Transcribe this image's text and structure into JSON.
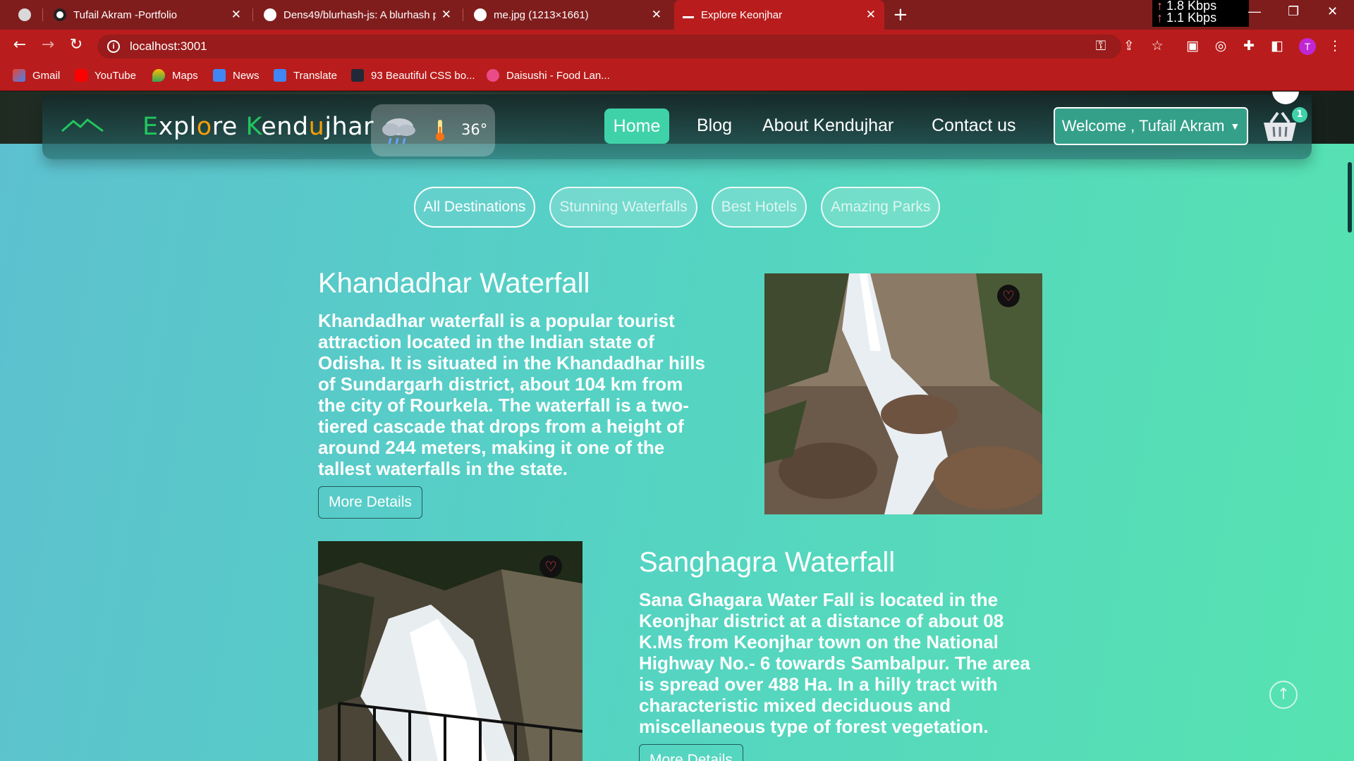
{
  "browser": {
    "tabs": [
      {
        "title": ""
      },
      {
        "title": "Tufail Akram -Portfolio"
      },
      {
        "title": "Dens49/blurhash-js: A blurhash p"
      },
      {
        "title": "me.jpg (1213×1661)"
      },
      {
        "title": "Explore Keonjhar"
      }
    ],
    "net_up": "1.8 Kbps",
    "net_down": "1.1 Kbps",
    "url": "localhost:3001",
    "profile_initial": "T",
    "bookmarks": [
      "Gmail",
      "YouTube",
      "Maps",
      "News",
      "Translate",
      "93 Beautiful CSS bo...",
      "Daisushi - Food Lan..."
    ]
  },
  "site": {
    "brand": {
      "e": "E",
      "xpl": "xpl",
      "o": "o",
      "re": "re ",
      "k": "K",
      "end": "end",
      "u": "u",
      "jhar": "jhar"
    },
    "temperature": "36°",
    "nav": {
      "home": "Home",
      "blog": "Blog",
      "about": "About Kendujhar",
      "contact": "Contact us"
    },
    "welcome": "Welcome , Tufail Akram",
    "cart_count": "1",
    "filters": [
      "All Destinations",
      "Stunning Waterfalls",
      "Best Hotels",
      "Amazing Parks"
    ],
    "cards": [
      {
        "title": "Khandadhar Waterfall",
        "description": "Khandadhar waterfall is a popular tourist attraction located in the Indian state of Odisha. It is situated in the Khandadhar hills of Sundargarh district, about 104 km from the city of Rourkela. The waterfall is a two-tiered cascade that drops from a height of around 244 meters, making it one of the tallest waterfalls in the state.",
        "button": "More Details"
      },
      {
        "title": "Sanghagra Waterfall",
        "description": "Sana Ghagara Water Fall is located in the Keonjhar district at a distance of about 08 K.Ms from Keonjhar town on the National Highway No.- 6 towards Sambalpur. The area is spread over 488 Ha. In a hilly tract with characteristic mixed deciduous and miscellaneous type of forest vegetation.",
        "button": "More Details"
      }
    ]
  },
  "colors": {
    "accent": "#3fd2a8",
    "chrome": "#b91c1c",
    "heart": "#ef4444"
  }
}
